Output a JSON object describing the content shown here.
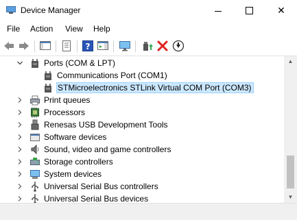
{
  "window": {
    "title": "Device Manager",
    "min_glyph": "",
    "max_glyph": "",
    "close_glyph": "✕"
  },
  "menu": [
    "File",
    "Action",
    "View",
    "Help"
  ],
  "toolbar": {
    "icons": [
      "back-arrow-icon",
      "forward-arrow-icon",
      "show-hide-console-tree-icon",
      "properties-icon",
      "help-icon",
      "action-pane-icon",
      "monitor-icon",
      "update-driver-icon",
      "uninstall-device-icon",
      "disable-device-icon"
    ]
  },
  "tree": {
    "items": [
      {
        "label": "Ports (COM & LPT)",
        "expanded": true,
        "level": 1,
        "icon": "port-icon"
      },
      {
        "label": "Communications Port (COM1)",
        "level": 2,
        "icon": "port-icon"
      },
      {
        "label": "STMicroelectronics STLink Virtual COM Port (COM3)",
        "level": 2,
        "icon": "port-icon",
        "selected": true
      },
      {
        "label": "Print queues",
        "level": 1,
        "icon": "printer-icon"
      },
      {
        "label": "Processors",
        "level": 1,
        "icon": "processor-icon"
      },
      {
        "label": "Renesas USB Development Tools",
        "level": 1,
        "icon": "usb-icon"
      },
      {
        "label": "Software devices",
        "level": 1,
        "icon": "software-device-icon"
      },
      {
        "label": "Sound, video and game controllers",
        "level": 1,
        "icon": "speaker-icon"
      },
      {
        "label": "Storage controllers",
        "level": 1,
        "icon": "storage-controller-icon"
      },
      {
        "label": "System devices",
        "level": 1,
        "icon": "system-device-icon"
      },
      {
        "label": "Universal Serial Bus controllers",
        "level": 1,
        "icon": "usb-controller-icon"
      },
      {
        "label": "Universal Serial Bus devices",
        "level": 1,
        "icon": "usb-device-icon"
      }
    ]
  },
  "colors": {
    "selection_bg": "#cce8ff",
    "selection_border": "#99d1ff",
    "uninstall_red": "#e02020"
  }
}
